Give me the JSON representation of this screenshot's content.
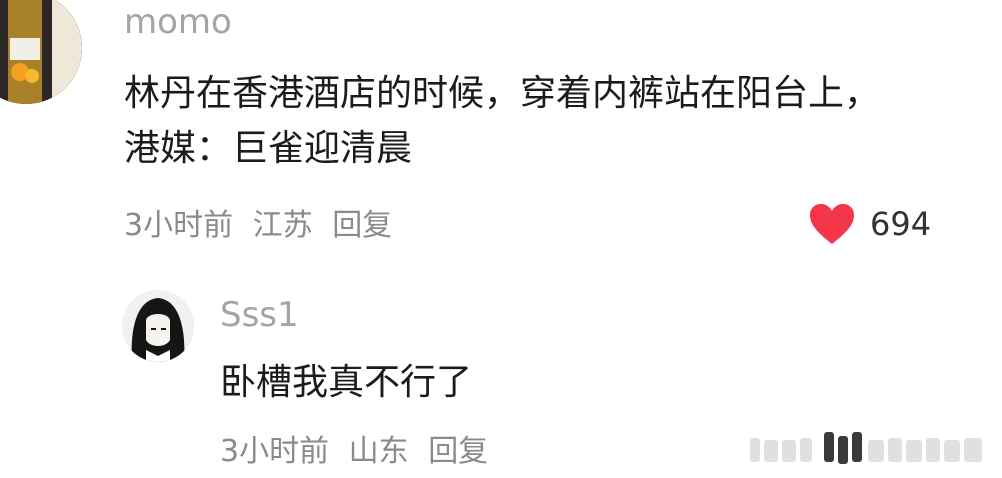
{
  "colors": {
    "accent_like": "#f5364a",
    "username": "#a4a4a4",
    "meta": "#8a8a8a",
    "text": "#1b1b1b"
  },
  "comments": [
    {
      "username": "momo",
      "lines": [
        "林丹在香港酒店的时候，穿着内裤站在阳台上，",
        "港媒：巨雀迎清晨"
      ],
      "time": "3小时前",
      "location": "江苏",
      "reply_label": "回复",
      "like_icon": "heart-icon",
      "like_count": "694"
    },
    {
      "username": "Sss1",
      "lines": [
        "卧槽我真不行了"
      ],
      "time": "3小时前",
      "location": "山东",
      "reply_label": "回复"
    }
  ]
}
